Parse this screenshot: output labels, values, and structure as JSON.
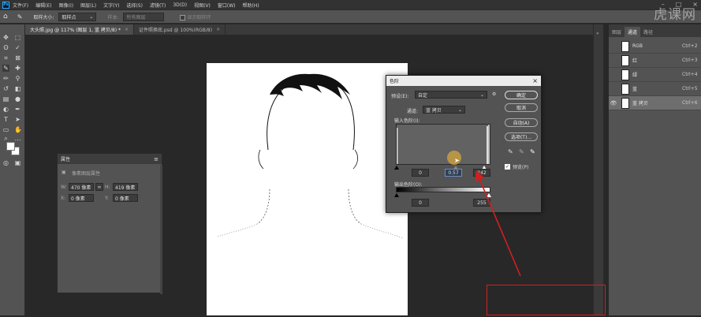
{
  "menu": {
    "items": [
      "文件(F)",
      "编辑(E)",
      "图像(I)",
      "图层(L)",
      "文字(Y)",
      "选择(S)",
      "滤镜(T)",
      "3D(D)",
      "视图(V)",
      "窗口(W)",
      "帮助(H)"
    ]
  },
  "options_bar": {
    "sample_size_label": "取样大小:",
    "sample_size_value": "取样点",
    "sample_label": "样本:",
    "sample_value": "所有图层",
    "show_ring_label": "显示取样环"
  },
  "watermark": "虎课网",
  "tabs": [
    {
      "label": "大头照.jpg @ 117% (图层 1, 蓝 拷贝/8) *",
      "close": "×",
      "active": true
    },
    {
      "label": "证件照换底.psd @ 100%(RGB/8)",
      "close": "×",
      "active": false
    }
  ],
  "properties": {
    "title": "属性",
    "subtitle": "像素图层属性",
    "w_label": "W:",
    "w_value": "470 像素",
    "h_label": "H:",
    "h_value": "419 像素",
    "x_label": "X:",
    "x_value": "0 像素",
    "y_label": "Y:",
    "y_value": "0 像素",
    "link_icon": "link-icon"
  },
  "channels": {
    "tabs": [
      "图层",
      "通道",
      "路径"
    ],
    "active_tab": 1,
    "rows": [
      {
        "name": "RGB",
        "shortcut": "Ctrl+2",
        "selected": false
      },
      {
        "name": "红",
        "shortcut": "Ctrl+3",
        "selected": false
      },
      {
        "name": "绿",
        "shortcut": "Ctrl+4",
        "selected": false
      },
      {
        "name": "蓝",
        "shortcut": "Ctrl+5",
        "selected": false
      },
      {
        "name": "蓝 拷贝",
        "shortcut": "Ctrl+6",
        "selected": true
      }
    ]
  },
  "levels": {
    "title": "色阶",
    "preset_label": "预设(E):",
    "preset_value": "自定",
    "channel_label": "通道:",
    "channel_value": "蓝 拷贝",
    "input_label": "输入色阶(I):",
    "input_black": "0",
    "input_gamma": "0.57",
    "input_white": "242",
    "output_label": "输出色阶(O):",
    "output_black": "0",
    "output_white": "255",
    "ok": "确定",
    "cancel": "取消",
    "auto": "自动(A)",
    "options": "选项(T)...",
    "preview_label": "预览(P)",
    "preview_checked": true
  },
  "colors": {
    "annotation_red": "#d21f1f",
    "cursor_highlight": "#d4a63e"
  }
}
